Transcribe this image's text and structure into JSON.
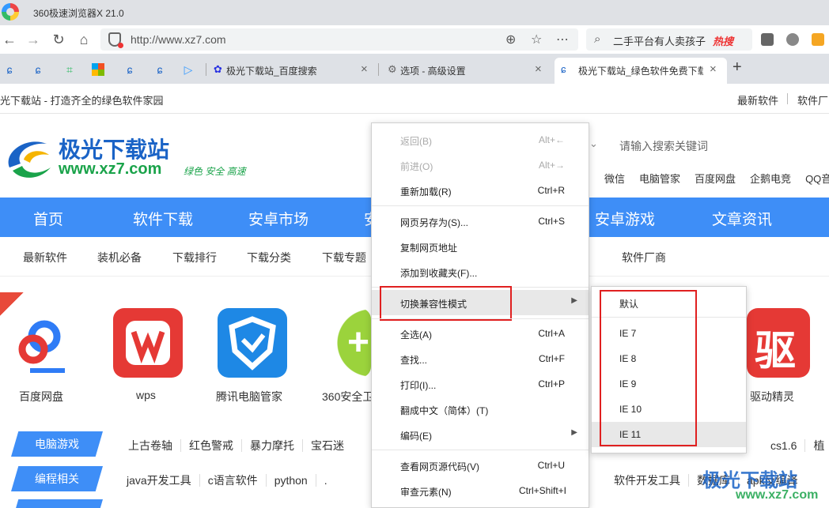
{
  "window": {
    "title": "360极速浏览器X 21.0"
  },
  "address": {
    "url": "http://www.xz7.com"
  },
  "search": {
    "query": "二手平台有人卖孩子",
    "hot_badge": "热搜"
  },
  "tabs": [
    {
      "label": "极光下载站_百度搜索"
    },
    {
      "label": "选项 - 高级设置"
    },
    {
      "label": "极光下载站_绿色软件免费下载"
    }
  ],
  "bookmarks": {
    "site_text": "光下载站 - 打造齐全的绿色软件家园",
    "right": [
      "最新软件",
      "软件厂"
    ]
  },
  "page": {
    "logo": {
      "name": "极光下载站",
      "url": "www.xz7.com",
      "slogan": "绿色 安全 高速"
    },
    "search_placeholder": "请输入搜索关键词",
    "top_links": [
      "微信",
      "电脑管家",
      "百度网盘",
      "企鹅电竞",
      "QQ音"
    ],
    "main_nav": [
      "首页",
      "软件下载",
      "安卓市场",
      "安卓游戏",
      "文章资讯"
    ],
    "sub_nav": [
      "最新软件",
      "装机必备",
      "下载排行",
      "下载分类",
      "下载专题",
      "软件厂商"
    ],
    "apps": [
      {
        "label": "百度网盘",
        "color": "#ffffff"
      },
      {
        "label": "wps",
        "color": "#e53935"
      },
      {
        "label": "腾讯电脑管家",
        "color": "#1e88e5"
      },
      {
        "label": "360安全卫",
        "color": "#43a047"
      },
      {
        "label": "驱动精灵",
        "color": "#e53935"
      }
    ],
    "categories": [
      {
        "label": "电脑游戏",
        "items": [
          "上古卷轴",
          "红色警戒",
          "暴力摩托",
          "宝石迷"
        ],
        "right": [
          "cs1.6",
          "植"
        ]
      },
      {
        "label": "编程相关",
        "items": [
          "java开发工具",
          "c语言软件",
          "python",
          "."
        ],
        "right": [
          "软件开发工具",
          "数据库",
          "apk反编译"
        ]
      }
    ],
    "watermark": {
      "text": "极光下载站",
      "url": "www.xz7.com"
    }
  },
  "context_menu": {
    "items": [
      {
        "label": "返回(B)",
        "shortcut": "Alt+←",
        "disabled": true
      },
      {
        "label": "前进(O)",
        "shortcut": "Alt+→",
        "disabled": true
      },
      {
        "label": "重新加载(R)",
        "shortcut": "Ctrl+R"
      },
      {
        "label": "网页另存为(S)...",
        "shortcut": "Ctrl+S"
      },
      {
        "label": "复制网页地址",
        "shortcut": ""
      },
      {
        "label": "添加到收藏夹(F)...",
        "shortcut": ""
      },
      {
        "label": "切换兼容性模式",
        "shortcut": "",
        "submenu": true
      },
      {
        "label": "全选(A)",
        "shortcut": "Ctrl+A"
      },
      {
        "label": "查找...",
        "shortcut": "Ctrl+F"
      },
      {
        "label": "打印(I)...",
        "shortcut": "Ctrl+P"
      },
      {
        "label": "翻成中文（简体）(T)",
        "shortcut": ""
      },
      {
        "label": "编码(E)",
        "shortcut": "",
        "submenu": true
      },
      {
        "label": "查看网页源代码(V)",
        "shortcut": "Ctrl+U"
      },
      {
        "label": "审查元素(N)",
        "shortcut": "Ctrl+Shift+I"
      }
    ]
  },
  "compat_submenu": {
    "items": [
      "默认",
      "IE 7",
      "IE 8",
      "IE 9",
      "IE 10",
      "IE 11"
    ]
  }
}
